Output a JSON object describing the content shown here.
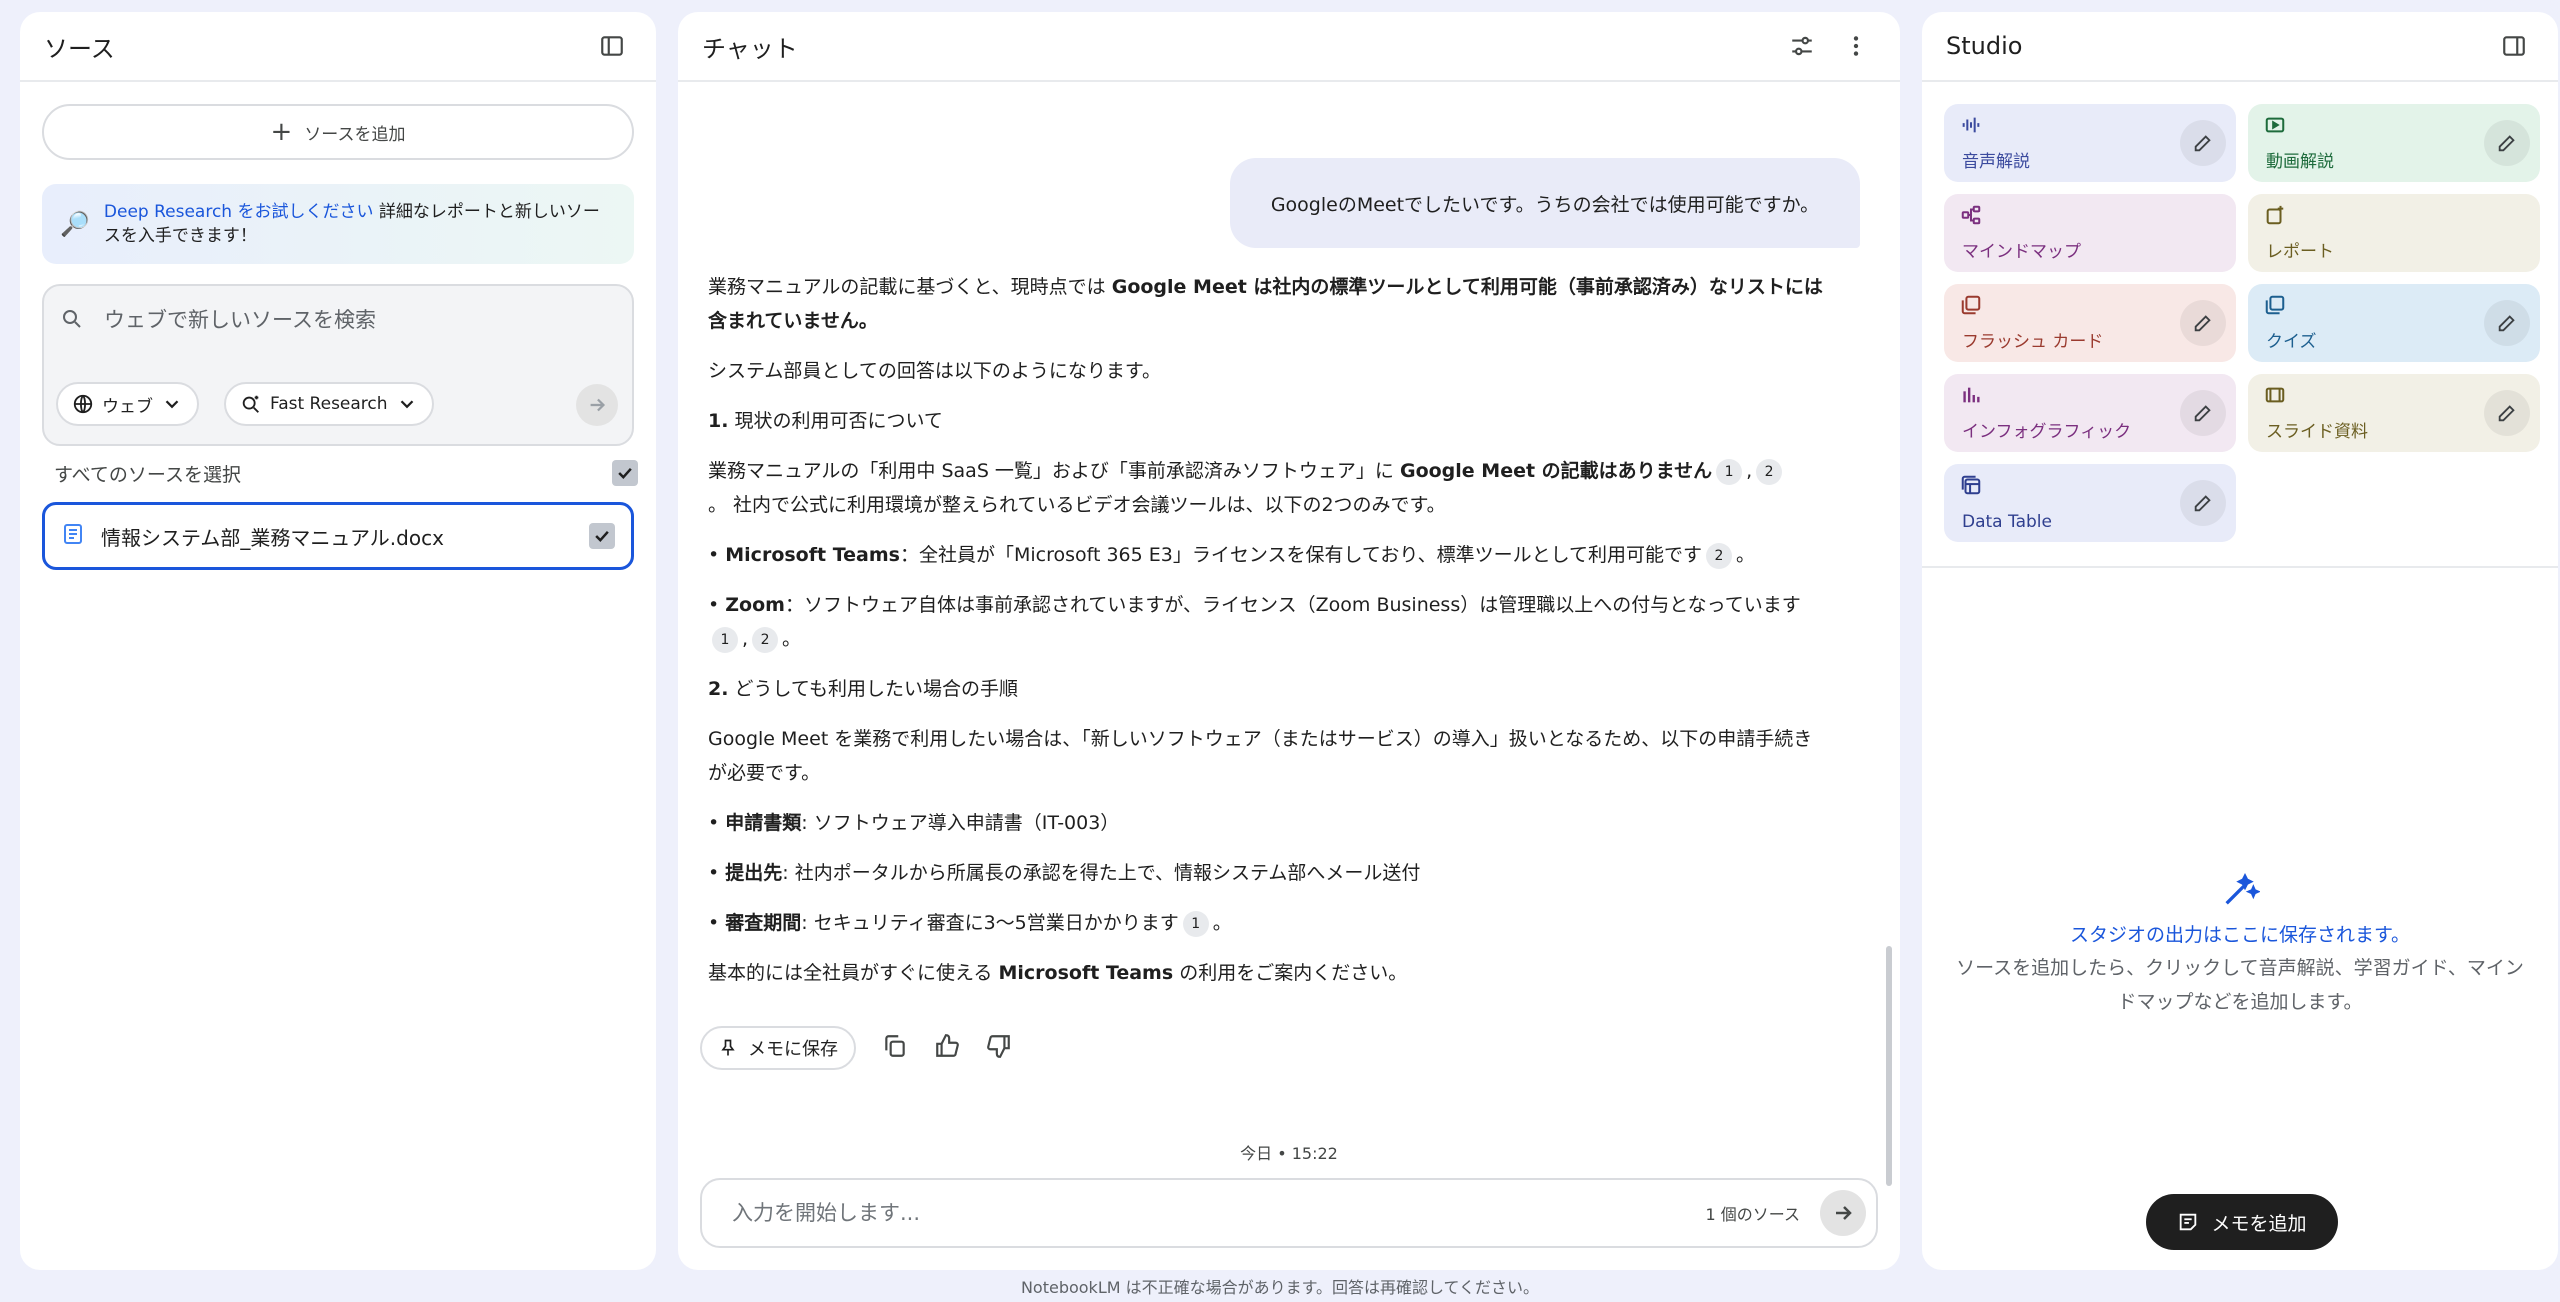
{
  "sources": {
    "title": "ソース",
    "add_source_label": "ソースを追加",
    "deep_research": {
      "link": "Deep Research をお試しください",
      "text": "詳細なレポートと新しいソースを入手できます！"
    },
    "search": {
      "placeholder": "ウェブで新しいソースを検索",
      "web_chip": "ウェブ",
      "mode_chip": "Fast Research"
    },
    "select_all_label": "すべてのソースを選択",
    "items": [
      {
        "name": "情報システム部_業務マニュアル.docx",
        "checked": true
      }
    ]
  },
  "chat": {
    "title": "チャット",
    "user_message": "GoogleのMeetでしたいです。うちの会社では使用可能ですか。",
    "answer": {
      "p1_a": "業務マニュアルの記載に基づくと、現時点では ",
      "p1_b": "Google Meet は社内の標準ツールとして利用可能（事前承認済み）なリストには含まれていません。",
      "p2": "システム部員としての回答は以下のようになります。",
      "h1_num": "1.",
      "h1": " 現状の利用可否について",
      "p3_a": "業務マニュアルの「利用中 SaaS 一覧」および「事前承認済みソフトウェア」に ",
      "p3_b": "Google Meet の記載はありません",
      "p3_c": "。 社内で公式に利用環境が整えられているビデオ会議ツールは、以下の2つのみです。",
      "b1_title": "Microsoft Teams",
      "b1_text": "：全社員が「Microsoft 365 E3」ライセンスを保有しており、標準ツールとして利用可能です",
      "b2_title": "Zoom",
      "b2_text": "：ソフトウェア自体は事前承認されていますが、ライセンス（Zoom Business）は管理職以上への付与となっています",
      "h2_num": "2.",
      "h2": " どうしても利用したい場合の手順",
      "p4": "Google Meet を業務で利用したい場合は、「新しいソフトウェア（またはサービス）の導入」扱いとなるため、以下の申請手続きが必要です。",
      "s1_title": "申請書類",
      "s1_text": ": ソフトウェア導入申請書（IT-003）",
      "s2_title": "提出先",
      "s2_text": ": 社内ポータルから所属長の承認を得た上で、情報システム部へメール送付",
      "s3_title": "審査期間",
      "s3_text": ": セキュリティ審査に3〜5営業日かかります",
      "p5_a": "基本的には全社員がすぐに使える ",
      "p5_b": "Microsoft Teams",
      "p5_c": " の利用をご案内ください。",
      "bullet": "•",
      "comma": ",",
      "period": "。",
      "cite_1": "1",
      "cite_2": "2"
    },
    "save_memo_label": "メモに保存",
    "timestamp": "今日 • 15:22",
    "input_placeholder": "入力を開始します...",
    "source_count": "1 個のソース"
  },
  "studio": {
    "title": "Studio",
    "tiles": [
      {
        "label": "音声解説",
        "bg": "#e8ebf9",
        "color": "#3b4a9e"
      },
      {
        "label": "動画解説",
        "bg": "#e3f3e9",
        "color": "#1e6b3c"
      },
      {
        "label": "マインドマップ",
        "bg": "#f2e8f2",
        "color": "#7b2f7f"
      },
      {
        "label": "レポート",
        "bg": "#f2f0e6",
        "color": "#6b5e21"
      },
      {
        "label": "フラッシュ カード",
        "bg": "#f8e8e6",
        "color": "#9a3a2e"
      },
      {
        "label": "クイズ",
        "bg": "#dcebf6",
        "color": "#1d5f8f"
      },
      {
        "label": "インフォグラフィック",
        "bg": "#f2e8f2",
        "color": "#7b2f7f"
      },
      {
        "label": "スライド資料",
        "bg": "#f2f0e6",
        "color": "#6b5e21"
      },
      {
        "label": "Data Table",
        "bg": "#e8ebf9",
        "color": "#2f3f8f"
      }
    ],
    "empty_title": "スタジオの出力はここに保存されます。",
    "empty_desc": "ソースを追加したら、クリックして音声解説、学習ガイド、マインドマップなどを追加します。",
    "add_memo_label": "メモを追加"
  },
  "footer": "NotebookLM は不正確な場合があります。回答は再確認してください。"
}
